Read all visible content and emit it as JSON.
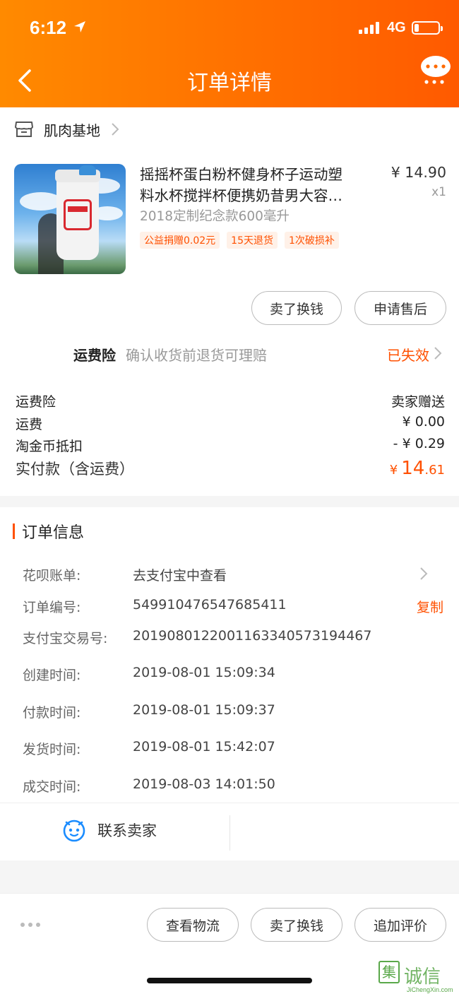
{
  "status_bar": {
    "time": "6:12",
    "network": "4G"
  },
  "header": {
    "title": "订单详情"
  },
  "shop": {
    "name": "肌肉基地"
  },
  "product": {
    "title_line1": "摇摇杯蛋白粉杯健身杯子运动塑",
    "title_line2": "料水杯搅拌杯便携奶昔男大容…",
    "price": "¥ 14.90",
    "quantity": "x1",
    "spec": "2018定制纪念款600毫升",
    "tags": [
      "公益捐赠0.02元",
      "15天退货",
      "1次破损补"
    ],
    "image_alt": "shaker bottle"
  },
  "item_actions": {
    "sell_label": "卖了换钱",
    "aftersale_label": "申请售后"
  },
  "insurance": {
    "label": "运费险",
    "desc": "确认收货前退货可理赔",
    "status": "已失效"
  },
  "fees": [
    {
      "label": "运费险",
      "value": "卖家赠送"
    },
    {
      "label": "运费",
      "value": "¥ 0.00"
    },
    {
      "label": "淘金币抵扣",
      "value": "- ¥ 0.29"
    }
  ],
  "total": {
    "label": "实付款（含运费）",
    "symbol": "¥",
    "integer": "14",
    "decimal": ".61"
  },
  "order_info": {
    "title": "订单信息",
    "huabei": {
      "label": "花呗账单:",
      "value": "去支付宝中查看"
    },
    "order_no": {
      "label": "订单编号:",
      "value": "549910476547685411",
      "copy": "复制"
    },
    "alipay_no": {
      "label": "支付宝交易号:",
      "value": "2019080122001163340573194467"
    },
    "created": {
      "label": "创建时间:",
      "value": "2019-08-01 15:09:34"
    },
    "paid": {
      "label": "付款时间:",
      "value": "2019-08-01 15:09:37"
    },
    "shipped": {
      "label": "发货时间:",
      "value": "2019-08-01 15:42:07"
    },
    "completed": {
      "label": "成交时间:",
      "value": "2019-08-03 14:01:50"
    }
  },
  "contact": {
    "label": "联系卖家"
  },
  "bottom_actions": {
    "logistics": "查看物流",
    "sell": "卖了换钱",
    "review": "追加评价"
  },
  "watermark": {
    "text": "诚信",
    "box": "集",
    "url": "JiChengXin.com"
  },
  "colors": {
    "accent": "#ff5000",
    "header_start": "#ff8a00",
    "header_end": "#ff5a00"
  }
}
